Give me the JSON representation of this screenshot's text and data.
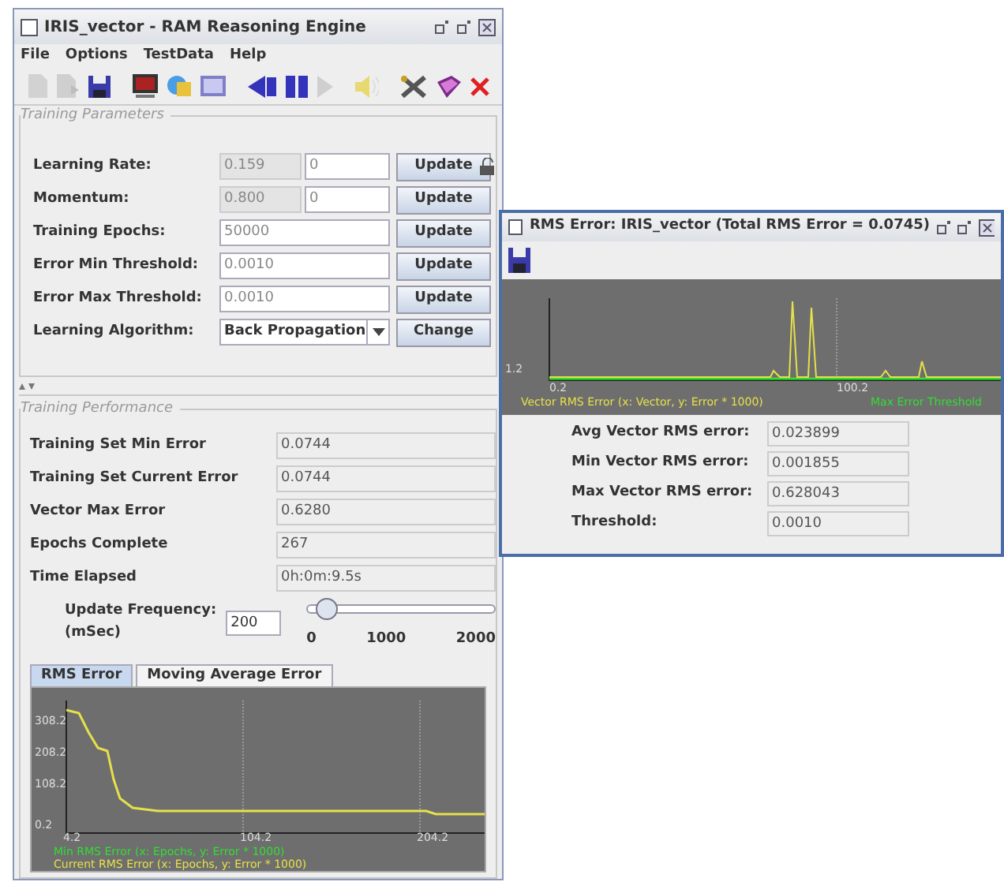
{
  "main_window": {
    "title": "IRIS_vector - RAM Reasoning Engine",
    "menu": [
      "File",
      "Options",
      "TestData",
      "Help"
    ],
    "training_parameters": {
      "title": "Training Parameters",
      "rows": [
        {
          "kind": "dual",
          "label": "Learning Rate:",
          "current": "0.159",
          "value": "0",
          "button": "Update"
        },
        {
          "kind": "dual",
          "label": "Momentum:",
          "current": "0.800",
          "value": "0",
          "button": "Update"
        },
        {
          "kind": "single",
          "label": "Training Epochs:",
          "value": "50000",
          "button": "Update"
        },
        {
          "kind": "single",
          "label": "Error Min Threshold:",
          "value": "0.0010",
          "button": "Update"
        },
        {
          "kind": "single",
          "label": "Error Max Threshold:",
          "value": "0.0010",
          "button": "Update"
        },
        {
          "kind": "select",
          "label": "Learning Algorithm:",
          "value": "Back Propagation",
          "button": "Change"
        }
      ]
    },
    "training_performance": {
      "title": "Training Performance",
      "rows": [
        {
          "label": "Training Set Min Error",
          "value": "0.0744"
        },
        {
          "label": "Training Set Current Error",
          "value": "0.0744"
        },
        {
          "label": "Vector Max Error",
          "value": "0.6280"
        },
        {
          "label": "Epochs Complete",
          "value": "267"
        },
        {
          "label": "Time Elapsed",
          "value": "0h:0m:9.5s"
        }
      ],
      "update_frequency": {
        "label": "Update Frequency:",
        "unit": "(mSec)",
        "value": "200",
        "level": 0.1,
        "ticks": [
          "0",
          "1000",
          "2000"
        ]
      }
    },
    "tabs": [
      {
        "label": "RMS Error",
        "selected": true
      },
      {
        "label": "Moving Average Error",
        "selected": false
      }
    ],
    "chart": {
      "y_ticks": [
        "308.2",
        "208.2",
        "108.2",
        "0.2"
      ],
      "x_ticks": [
        "4.2",
        "104.2",
        "204.2"
      ],
      "legend": [
        {
          "text": "Min RMS Error (x: Epochs, y: Error * 1000)",
          "color": "#33dd33"
        },
        {
          "text": "Current RMS Error (x: Epochs, y: Error * 1000)",
          "color": "#e6e04a"
        }
      ]
    }
  },
  "rms_window": {
    "title": "RMS Error: IRIS_vector (Total RMS Error = 0.0745)",
    "chart": {
      "y_ticks": [
        "1.2"
      ],
      "x_ticks": [
        "0.2",
        "100.2"
      ],
      "legend": [
        {
          "text": "Vector RMS Error (x: Vector, y: Error * 1000)",
          "color": "#e6e04a"
        },
        {
          "text": "Max Error Threshold",
          "color": "#33dd33"
        }
      ]
    },
    "stats": [
      {
        "label": "Avg Vector RMS error:",
        "value": "0.023899"
      },
      {
        "label": "Min Vector RMS error:",
        "value": "0.001855"
      },
      {
        "label": "Max Vector RMS error:",
        "value": "0.628043"
      },
      {
        "label": "Threshold:",
        "value": "0.0010"
      }
    ]
  }
}
